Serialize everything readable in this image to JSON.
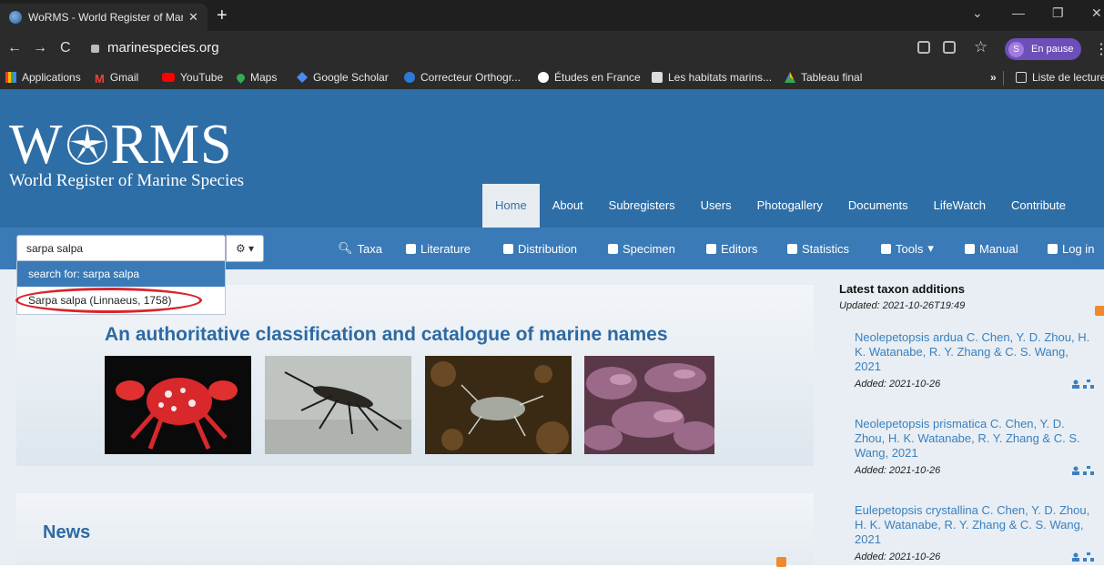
{
  "browser": {
    "tab_title": "WoRMS - World Register of Mari",
    "url": "marinespecies.org",
    "profile_initial": "S",
    "profile_status": "En pause",
    "bookmarks": [
      {
        "label": "Applications",
        "icon": "apps-grid-icon"
      },
      {
        "label": "Gmail",
        "icon": "gmail-icon"
      },
      {
        "label": "YouTube",
        "icon": "youtube-icon"
      },
      {
        "label": "Maps",
        "icon": "maps-pin-icon"
      },
      {
        "label": "Google Scholar",
        "icon": "scholar-cap-icon"
      },
      {
        "label": "Correcteur Orthogr...",
        "icon": "globe-icon"
      },
      {
        "label": "Études en France",
        "icon": "etudes-icon"
      },
      {
        "label": "Les habitats marins...",
        "icon": "habitats-icon"
      },
      {
        "label": "Tableau final",
        "icon": "drive-icon"
      }
    ],
    "more_bookmarks": "»",
    "reading_list": "Liste de lecture"
  },
  "site": {
    "logo_text_left": "W",
    "logo_text_right": "RMS",
    "logo_subtitle": "World Register of Marine Species",
    "topnav": [
      "Home",
      "About",
      "Subregisters",
      "Users",
      "Photogallery",
      "Documents",
      "LifeWatch",
      "Contribute"
    ],
    "active_topnav": "Home",
    "search_value": "sarpa salpa",
    "subnav": [
      "Taxa",
      "Literature",
      "Distribution",
      "Specimen",
      "Editors",
      "Statistics",
      "Tools",
      "Manual",
      "Log in"
    ],
    "tools_caret": "▾",
    "dropdown": {
      "search_for": "search for: sarpa salpa",
      "result": "Sarpa salpa (Linnaeus, 1758)"
    },
    "tagline": "An authoritative classification and catalogue of marine names",
    "news_heading": "News",
    "latest": {
      "heading": "Latest taxon additions",
      "updated": "Updated: 2021-10-26T19:49",
      "items": [
        {
          "name": "Neolepetopsis ardua C. Chen, Y. D. Zhou, H. K. Watanabe, R. Y. Zhang & C. S. Wang, 2021",
          "added": "Added: 2021-10-26"
        },
        {
          "name": "Neolepetopsis prismatica C. Chen, Y. D. Zhou, H. K. Watanabe, R. Y. Zhang & C. S. Wang, 2021",
          "added": "Added: 2021-10-26"
        },
        {
          "name": "Eulepetopsis crystallina C. Chen, Y. D. Zhou, H. K. Watanabe, R. Y. Zhang & C. S. Wang, 2021",
          "added": "Added: 2021-10-26"
        }
      ]
    },
    "colors": {
      "brand_blue": "#2e6ea6",
      "toolbar_blue": "#3a7ab6",
      "link": "#3a80c0",
      "highlight_ring": "#d8262c"
    }
  }
}
